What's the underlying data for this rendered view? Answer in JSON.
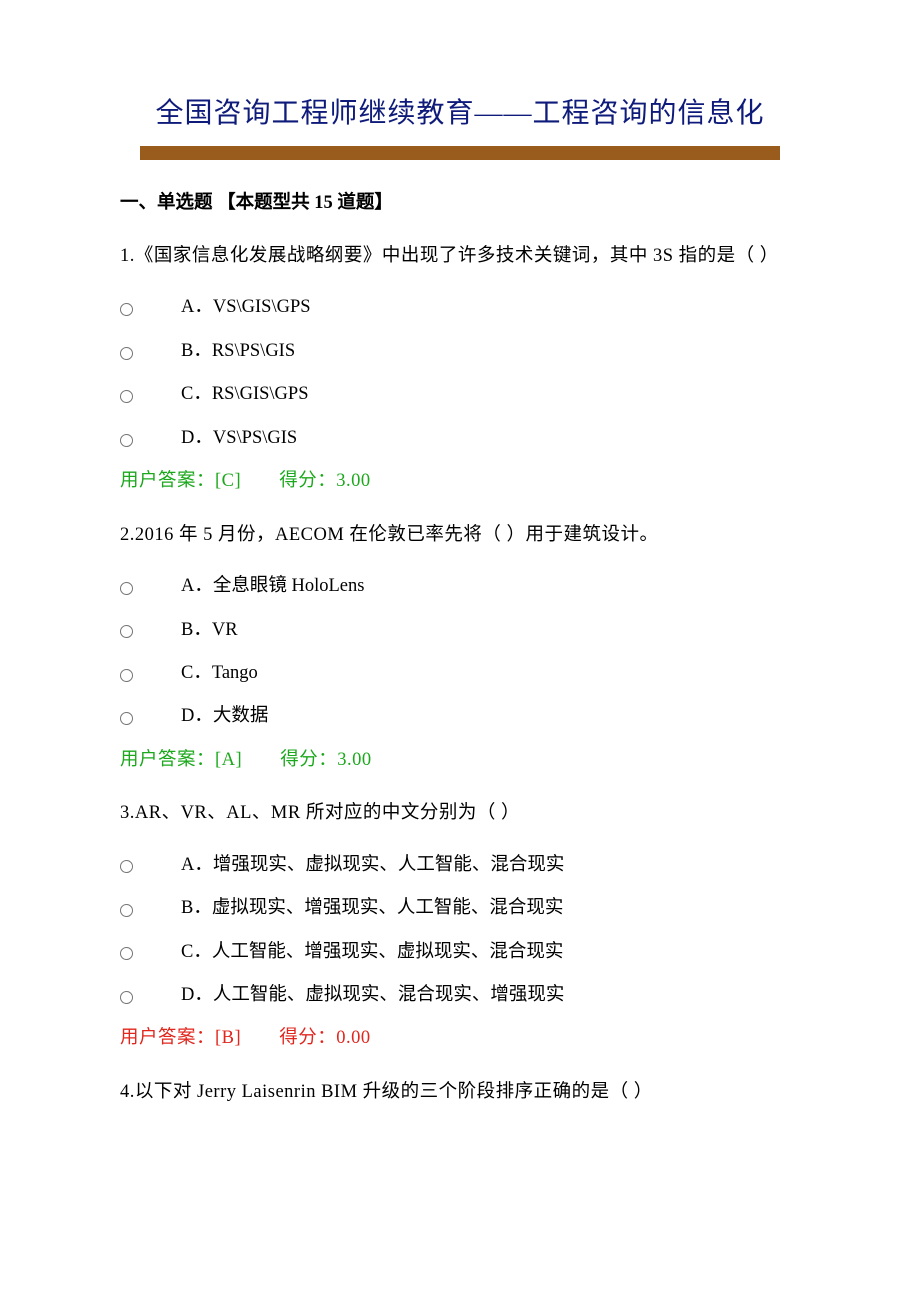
{
  "title": "全国咨询工程师继续教育——工程咨询的信息化",
  "section_header": "一、单选题 【本题型共 15 道题】",
  "questions": [
    {
      "num": "1.",
      "stem": "《国家信息化发展战略纲要》中出现了许多技术关键词，其中 3S 指的是（   ）",
      "options": [
        "A．VS\\GIS\\GPS",
        "B．RS\\PS\\GIS",
        "C．RS\\GIS\\GPS",
        "D．VS\\PS\\GIS"
      ],
      "answer": "[C]",
      "answer_label": "用户答案：",
      "score_label": "得分：",
      "score": "3.00",
      "correct": true
    },
    {
      "num": "2.",
      "stem": "2016 年 5 月份，AECOM 在伦敦已率先将（  ）用于建筑设计。",
      "options": [
        "A．全息眼镜 HoloLens",
        "B．VR",
        "C．Tango",
        "D．大数据"
      ],
      "answer": "[A]",
      "answer_label": "用户答案：",
      "score_label": "得分：",
      "score": "3.00",
      "correct": true
    },
    {
      "num": "3.",
      "stem": "AR、VR、AL、MR 所对应的中文分别为（   ）",
      "options": [
        "A．增强现实、虚拟现实、人工智能、混合现实",
        "B．虚拟现实、增强现实、人工智能、混合现实",
        "C．人工智能、增强现实、虚拟现实、混合现实",
        "D．人工智能、虚拟现实、混合现实、增强现实"
      ],
      "answer": "[B]",
      "answer_label": "用户答案：",
      "score_label": "得分：",
      "score": "0.00",
      "correct": false
    },
    {
      "num": "4.",
      "stem": "以下对 Jerry Laisenrin BIM 升级的三个阶段排序正确的是（   ）",
      "options": [],
      "answer": "",
      "answer_label": "",
      "score_label": "",
      "score": "",
      "correct": true
    }
  ]
}
